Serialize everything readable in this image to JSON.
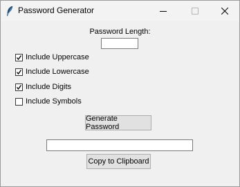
{
  "window": {
    "title": "Password Generator",
    "icon": "feather-icon"
  },
  "controls": {
    "minimize_icon": "minimize-icon",
    "maximize_icon": "maximize-icon",
    "close_icon": "close-icon"
  },
  "form": {
    "length_label": "Password Length:",
    "length_value": "",
    "options": [
      {
        "label": "Include Uppercase",
        "checked": true
      },
      {
        "label": "Include Lowercase",
        "checked": true
      },
      {
        "label": "Include Digits",
        "checked": true
      },
      {
        "label": "Include Symbols",
        "checked": false
      }
    ],
    "generate_label": "Generate Password",
    "password_value": "",
    "copy_label": "Copy to Clipboard"
  }
}
